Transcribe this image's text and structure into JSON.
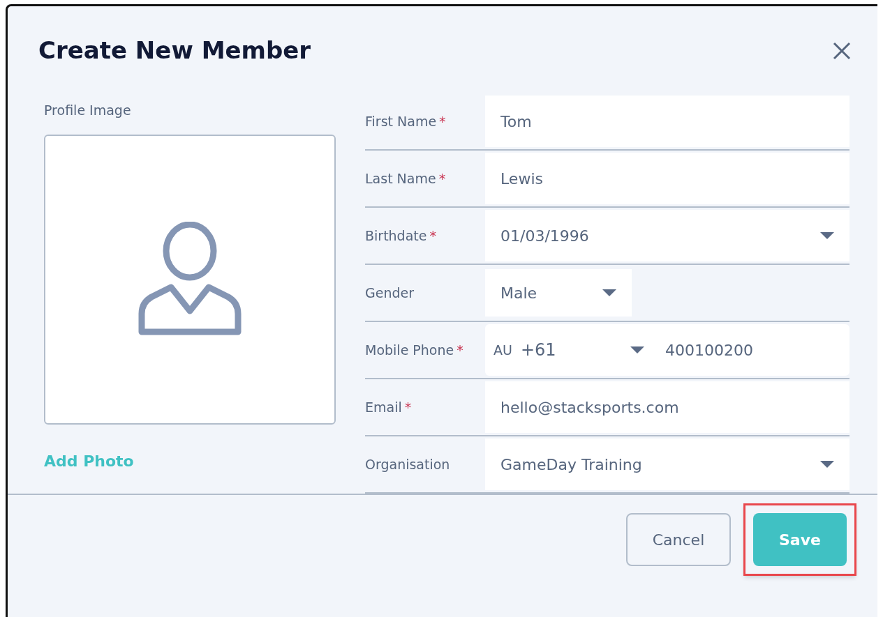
{
  "dialog": {
    "title": "Create New Member"
  },
  "profile": {
    "label": "Profile Image",
    "action": "Add Photo"
  },
  "fields": [
    {
      "kind": "text",
      "label": "First Name",
      "required_mark": "*",
      "value": "Tom"
    },
    {
      "kind": "text",
      "label": "Last Name",
      "required_mark": "*",
      "value": "Lewis"
    },
    {
      "kind": "select",
      "label": "Birthdate",
      "required_mark": "*",
      "value": "01/03/1996"
    },
    {
      "kind": "short_select",
      "label": "Gender",
      "value": "Male"
    },
    {
      "kind": "phone",
      "label": "Mobile Phone",
      "required_mark": "*",
      "country": "AU",
      "code": "+61",
      "value": "400100200"
    },
    {
      "kind": "text",
      "label": "Email",
      "required_mark": "*",
      "value": "hello@stacksports.com"
    },
    {
      "kind": "select",
      "label": "Organisation",
      "value": "GameDay Training"
    }
  ],
  "buttons": [
    {
      "kind": "secondary",
      "label": "Cancel",
      "highlighted": false
    },
    {
      "kind": "primary",
      "label": "Save",
      "highlighted": true
    }
  ]
}
